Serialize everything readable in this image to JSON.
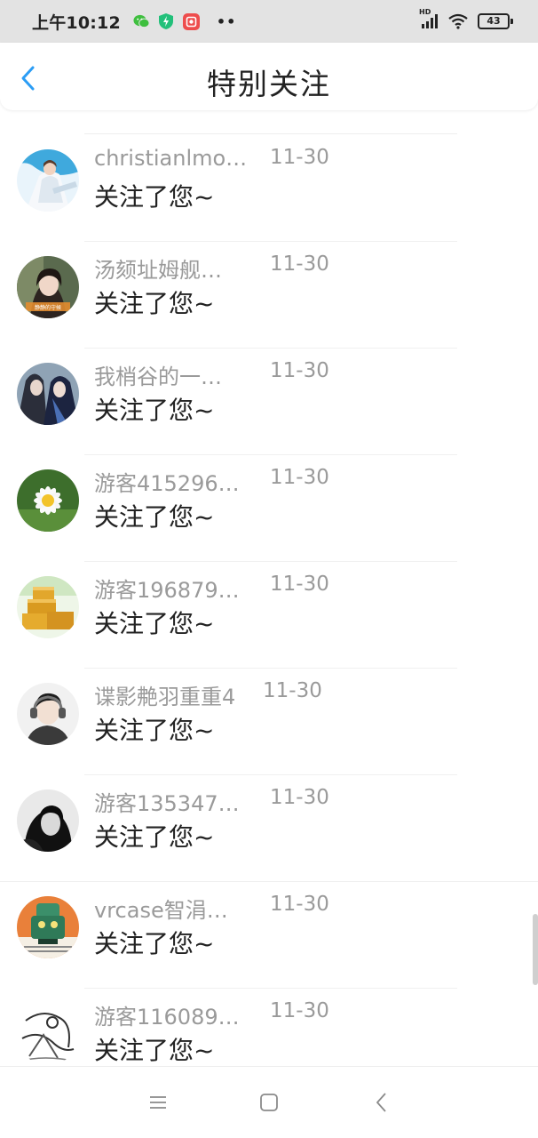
{
  "status_bar": {
    "time": "上午10:12",
    "dots": "••",
    "network": "HD",
    "battery": "43",
    "icons": [
      "wechat-icon",
      "shield-bolt-icon",
      "red-app-icon",
      "signal-icon",
      "wifi-icon",
      "battery-icon"
    ]
  },
  "header": {
    "title": "特别关注",
    "back_icon": "chevron-left-icon",
    "accent": "#2b9df5"
  },
  "list": {
    "items": [
      {
        "name": "christianlmo…",
        "date": "11-30",
        "message": "关注了您~",
        "avatar": "avatar-blue-figure"
      },
      {
        "name": "汤颏址姆舰…",
        "date": "11-30",
        "message": "关注了您~",
        "avatar": "avatar-girl-photo"
      },
      {
        "name": "我梢谷的一…",
        "date": "11-30",
        "message": "关注了您~",
        "avatar": "avatar-anime-couple"
      },
      {
        "name": "游客415296…",
        "date": "11-30",
        "message": "关注了您~",
        "avatar": "avatar-daisy"
      },
      {
        "name": "游客196879…",
        "date": "11-30",
        "message": "关注了您~",
        "avatar": "avatar-cake"
      },
      {
        "name": "谍影艴羽重重4",
        "date": "11-30",
        "message": "关注了您~",
        "avatar": "avatar-headphone-boy"
      },
      {
        "name": "游客135347…",
        "date": "11-30",
        "message": "关注了您~",
        "avatar": "avatar-bw-girl"
      },
      {
        "name": "vrcase智涓…",
        "date": "11-30",
        "message": "关注了您~",
        "avatar": "avatar-cartoon"
      },
      {
        "name": "游客116089…",
        "date": "11-30",
        "message": "关注了您~",
        "avatar": "avatar-sketch"
      }
    ]
  },
  "nav_bar": {
    "icons": [
      "menu-icon",
      "home-square-icon",
      "back-triangle-icon"
    ]
  }
}
